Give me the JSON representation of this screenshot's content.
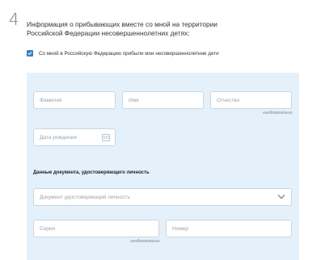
{
  "step": {
    "number": "4"
  },
  "section": {
    "title": "Информация о прибывающих вместе со мной на территории Российской Федерации несовершеннолетних детях:"
  },
  "children_checkbox": {
    "checked": true,
    "label": "Со мной в Российскую Федерацию прибыли мои несовершеннолетние дети"
  },
  "form": {
    "surname_placeholder": "Фамилия",
    "name_placeholder": "Имя",
    "patronymic_placeholder": "Отчество",
    "patronymic_hint": "необязательно",
    "birthdate_placeholder": "Дата рождения",
    "document_heading": "Данные документа, удостоверяющего личность",
    "document_type_placeholder": "Документ удостоверяющий личность",
    "series_placeholder": "Серия",
    "series_hint": "необязательно",
    "number_placeholder": "Номер"
  },
  "colors": {
    "accent": "#3d7fbf",
    "panel": "#e4f1fb"
  }
}
